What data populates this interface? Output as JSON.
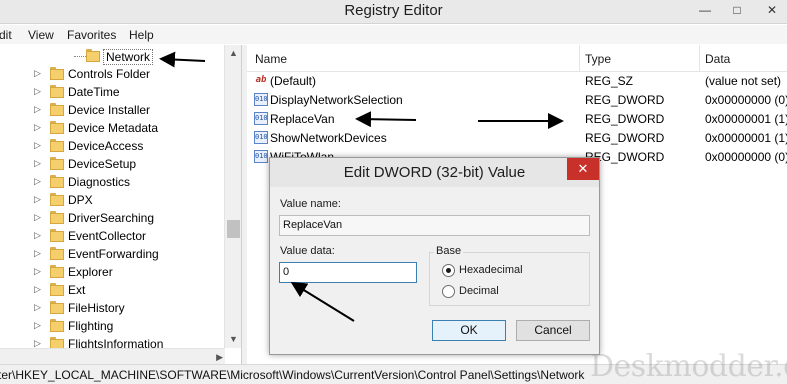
{
  "window": {
    "title": "Registry Editor",
    "controls": {
      "minimize": "—",
      "maximize": "□",
      "close": "✕"
    }
  },
  "menu": [
    "dit",
    "View",
    "Favorites",
    "Help"
  ],
  "tree": {
    "selected": "Network",
    "items": [
      "Controls Folder",
      "DateTime",
      "Device Installer",
      "Device Metadata",
      "DeviceAccess",
      "DeviceSetup",
      "Diagnostics",
      "DPX",
      "DriverSearching",
      "EventCollector",
      "EventForwarding",
      "Explorer",
      "Ext",
      "FileHistory",
      "Flighting",
      "FlightsInformation"
    ]
  },
  "list": {
    "columns": {
      "name": "Name",
      "type": "Type",
      "data": "Data"
    },
    "rows": [
      {
        "icon": "string-value-icon",
        "icon_text": "ab",
        "name": "(Default)",
        "type": "REG_SZ",
        "data": "(value not set)"
      },
      {
        "icon": "dword-value-icon",
        "icon_text": "010",
        "name": "DisplayNetworkSelection",
        "type": "REG_DWORD",
        "data": "0x00000000 (0)"
      },
      {
        "icon": "dword-value-icon",
        "icon_text": "010",
        "name": "ReplaceVan",
        "type": "REG_DWORD",
        "data": "0x00000001 (1)"
      },
      {
        "icon": "dword-value-icon",
        "icon_text": "010",
        "name": "ShowNetworkDevices",
        "type": "REG_DWORD",
        "data": "0x00000001 (1)"
      },
      {
        "icon": "dword-value-icon",
        "icon_text": "010",
        "name": "WiFiToWlan",
        "type": "REG_DWORD",
        "data": "0x00000000 (0)"
      }
    ]
  },
  "dialog": {
    "title": "Edit DWORD (32-bit) Value",
    "value_name_label": "Value name:",
    "value_name": "ReplaceVan",
    "value_data_label": "Value data:",
    "value_data": "0",
    "base_label": "Base",
    "base_options": [
      "Hexadecimal",
      "Decimal"
    ],
    "base_selected": "Hexadecimal",
    "ok_label": "OK",
    "cancel_label": "Cancel"
  },
  "status_bar": {
    "path": "ter\\HKEY_LOCAL_MACHINE\\SOFTWARE\\Microsoft\\Windows\\CurrentVersion\\Control Panel\\Settings\\Network"
  },
  "watermark": "Deskmodder.de",
  "colors": {
    "close_red": "#c7312a",
    "folder_yellow": "#f4cf6b",
    "focus_blue": "#3c7fb1"
  }
}
